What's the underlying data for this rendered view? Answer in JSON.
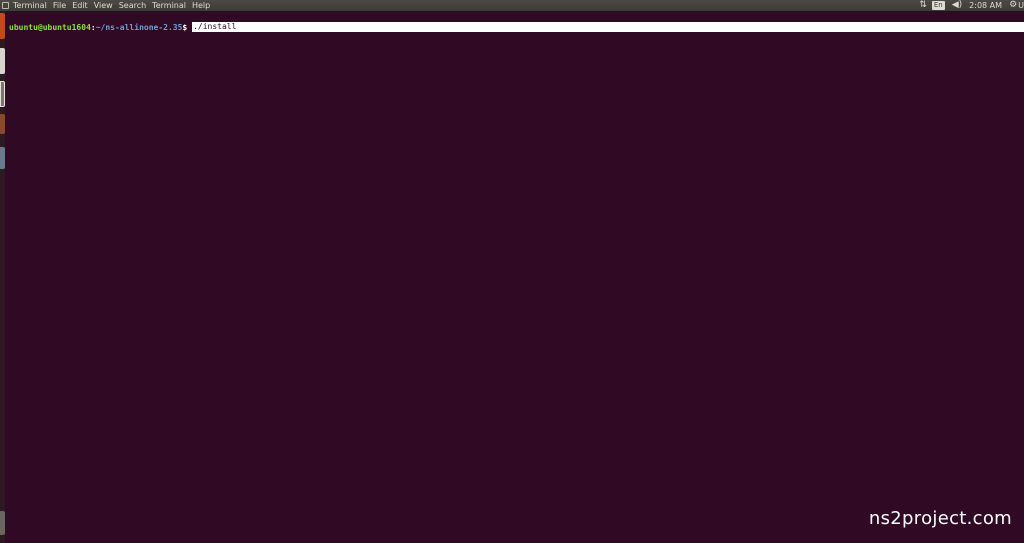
{
  "panel": {
    "menu": [
      "Terminal",
      "File",
      "Edit",
      "View",
      "Search",
      "Terminal",
      "Help"
    ],
    "tray": {
      "network_icon": "network-updown-icon",
      "keyboard_layout": "En",
      "volume_icon": "volume-icon",
      "clock": "2:08 AM",
      "settings_icon": "gear-icon",
      "user_initial": "U"
    }
  },
  "terminal": {
    "user_host": "ubuntu@ubuntu1604",
    "colon": ":",
    "cwd": "~/ns-allinone-2.35",
    "dollar": "$ ",
    "command": "./install"
  },
  "watermark": "ns2project.com"
}
